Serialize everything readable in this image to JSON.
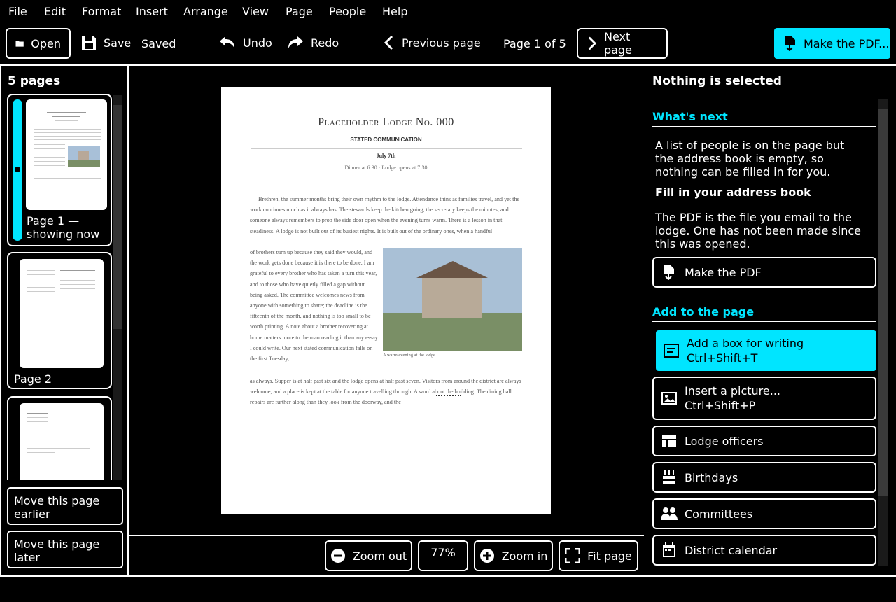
{
  "menu": [
    "File",
    "Edit",
    "Format",
    "Insert",
    "Arrange",
    "View",
    "Page",
    "People",
    "Help"
  ],
  "toolbar": {
    "open": "Open",
    "save": "Save",
    "saved_status": "Saved",
    "undo": "Undo",
    "redo": "Redo",
    "prev_page": "Previous page",
    "page_indicator": "Page 1 of 5",
    "next_page": "Next page",
    "make_pdf": "Make the PDF..."
  },
  "pages_panel": {
    "title": "5 pages",
    "page1_label": "Page 1 — showing now",
    "page2_label": "Page 2",
    "move_earlier": "Move this page earlier",
    "move_later": "Move this page later"
  },
  "document": {
    "title": "Placeholder Lodge No. 000",
    "subtitle": "STATED COMMUNICATION",
    "date": "July 7th",
    "times": "Dinner at 6:30 · Lodge opens at 7:30",
    "para_full_1": "Brethren, the summer months bring their own rhythm to the lodge. Attendance thins as families travel, and yet the work continues much as it always has. The stewards keep the kitchen going, the secretary keeps the minutes, and someone always remembers to prop the side door open when the evening turns warm. There is a lesson in that steadiness. A lodge is not built out of its busiest nights. It is built out of the ordinary ones, when a handful",
    "para_col": "of brothers turn up because they said they would, and the work gets done because it is there to be done. I am grateful to every brother who has taken a turn this year, and to those who have quietly filled a gap without being asked. The committee welcomes news from anyone with something to share; the deadline is the fifteenth of the month, and nothing is too small to be worth printing. A note about a brother recovering at home matters more to the man reading it than any essay I could write. Our next stated communication falls on the first Tuesday,",
    "para_full_2": "as always. Supper is at half past six and the lodge opens at half past seven. Visitors from around the district are always welcome, and a place is kept at the table for anyone travelling through. A word about the building. The dining hall repairs are further along than they look from the doorway, and the",
    "caption": "A warm evening at the lodge."
  },
  "zoom": {
    "zoom_out": "Zoom out",
    "level": "77%",
    "zoom_in": "Zoom in",
    "fit": "Fit page"
  },
  "right_panel": {
    "selection": "Nothing is selected",
    "whats_next": "What's next",
    "address_msg": "A list of people is on the page but the address book is empty, so nothing can be filled in for you.",
    "fill_address": "Fill in your address book",
    "pdf_msg": "The PDF is the file you email to the lodge. One has not been made since this was opened.",
    "make_pdf": "Make the PDF",
    "add_to_page": "Add to the page",
    "add_text_box": "Add a box for writing",
    "add_text_box_shortcut": "Ctrl+Shift+T",
    "insert_picture": "Insert a picture...",
    "insert_picture_shortcut": "Ctrl+Shift+P",
    "lodge_officers": "Lodge officers",
    "birthdays": "Birthdays",
    "committees": "Committees",
    "district_calendar": "District calendar"
  },
  "colors": {
    "accent": "#00e5ff",
    "background": "#000000"
  }
}
